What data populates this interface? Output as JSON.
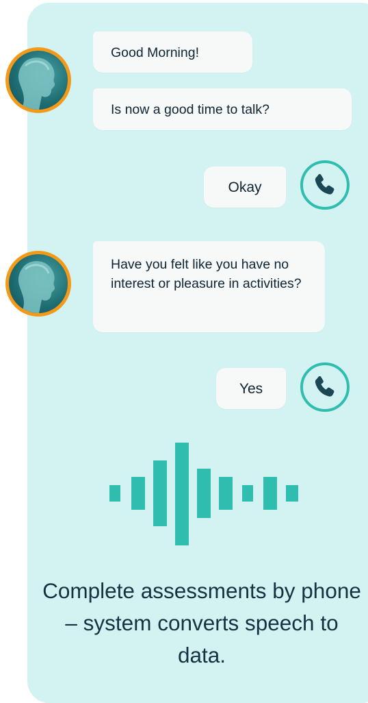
{
  "chat": {
    "messages": [
      {
        "sender": "agent",
        "text": "Good Morning!"
      },
      {
        "sender": "agent",
        "text": "Is now a good time to talk?"
      },
      {
        "sender": "user",
        "text": "Okay"
      },
      {
        "sender": "agent",
        "text": "Have you felt like you have no interest or pleasure in activities?"
      },
      {
        "sender": "user",
        "text": "Yes"
      }
    ]
  },
  "icons": {
    "agent_avatar": "woman-profile-avatar",
    "user_icon": "phone-icon",
    "audio": "sound-wave-icon"
  },
  "colors": {
    "card_bg": "#d3f2f2",
    "accent_teal": "#2fbdb0",
    "avatar_ring": "#f49a18",
    "phone_glyph": "#1b4654",
    "bubble_bg": "#f7f8f8",
    "text_dark": "#0e2433"
  },
  "caption": "Complete assessments by phone – system converts speech to data."
}
